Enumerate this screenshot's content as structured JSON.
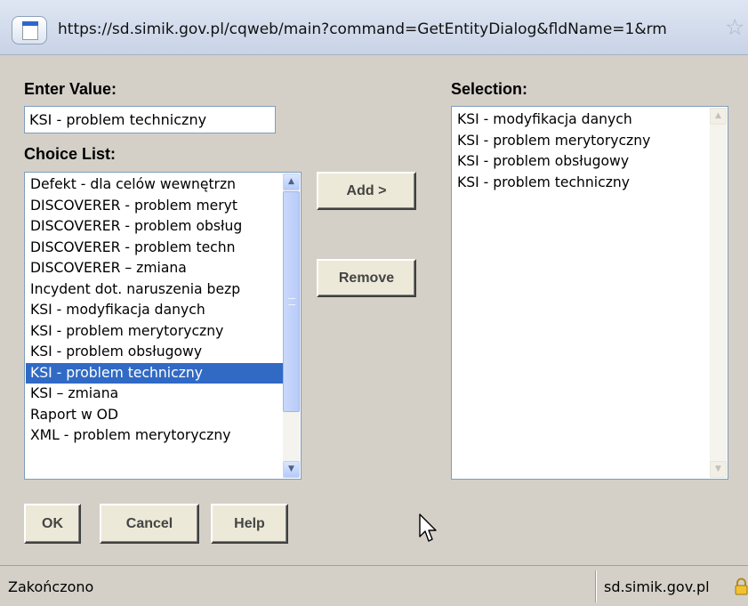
{
  "browser": {
    "url": "https://sd.simik.gov.pl/cqweb/main?command=GetEntityDialog&fldName=1&rm",
    "favicon_icon": "page-icon",
    "bookmark_icon": "star-icon"
  },
  "dialog": {
    "enter_value_label": "Enter Value:",
    "enter_value": "KSI - problem techniczny",
    "choice_list_label": "Choice List:",
    "choice_list": [
      "Defekt - dla celów wewnętrzn",
      "DISCOVERER - problem meryt",
      "DISCOVERER - problem obsług",
      "DISCOVERER - problem techn",
      "DISCOVERER – zmiana",
      "Incydent dot. naruszenia bezp",
      "KSI - modyfikacja danych",
      "KSI - problem merytoryczny",
      "KSI - problem obsługowy",
      "KSI - problem techniczny",
      "KSI – zmiana",
      "Raport w OD",
      "XML - problem merytoryczny"
    ],
    "choice_selected_index": 9,
    "selection_label": "Selection:",
    "selection_list": [
      "KSI - modyfikacja danych",
      "KSI - problem merytoryczny",
      "KSI - problem obsługowy",
      "KSI - problem techniczny"
    ],
    "add_label": "Add >",
    "remove_label": "Remove",
    "ok_label": "OK",
    "cancel_label": "Cancel",
    "help_label": "Help"
  },
  "status_bar": {
    "text": "Zakończono",
    "domain": "sd.simik.gov.pl",
    "lock_icon": "lock-icon"
  },
  "colors": {
    "selection_highlight": "#316ac5",
    "dialog_background": "#d4d0c8"
  }
}
